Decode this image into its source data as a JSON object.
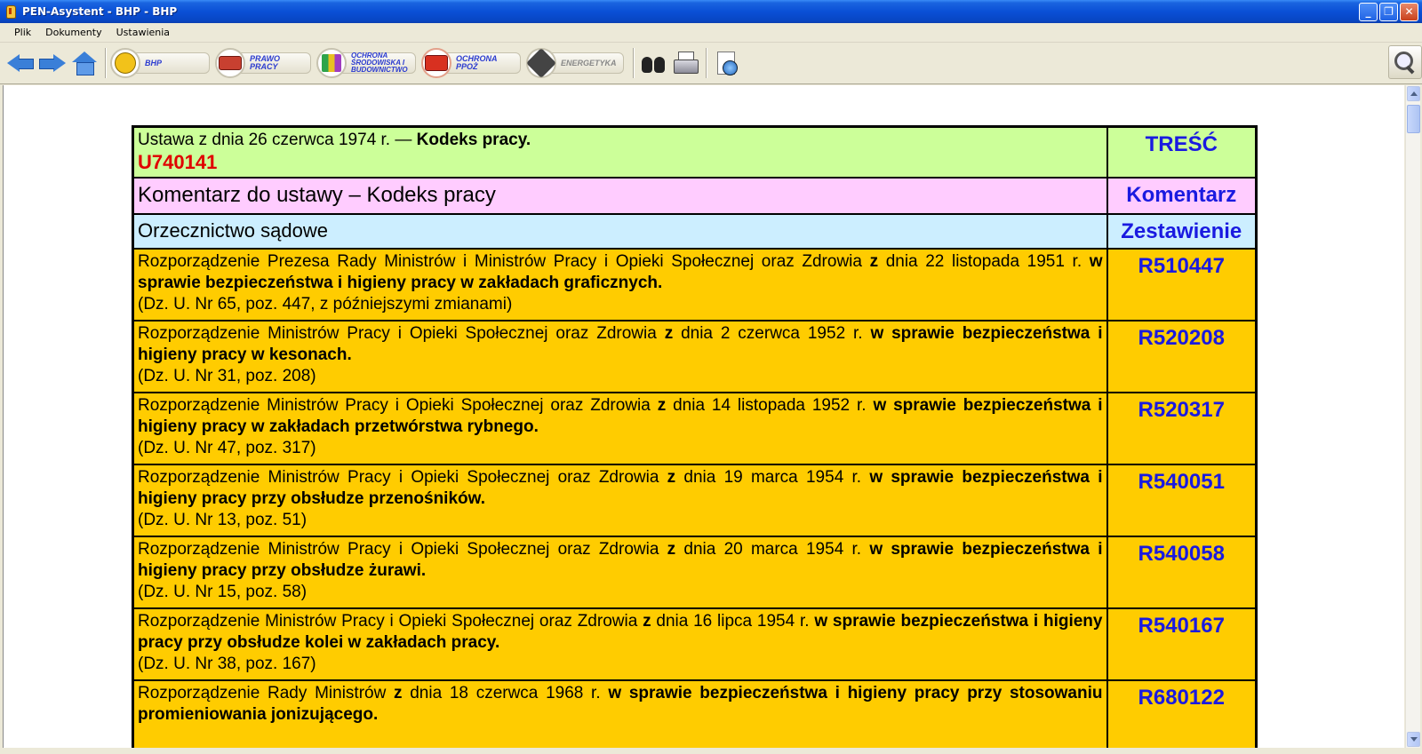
{
  "window": {
    "title": "PEN-Asystent - BHP - BHP",
    "buttons": {
      "minimize": "_",
      "maximize": "❐",
      "close": "✕"
    }
  },
  "menu": [
    "Plik",
    "Dokumenty",
    "Ustawienia"
  ],
  "toolbar": {
    "categories": [
      {
        "id": "bhp",
        "label": "BHP",
        "icon": "safety-worker-icon"
      },
      {
        "id": "prawo-pracy",
        "label": "PRAWO PRACY",
        "icon": "law-building-icon"
      },
      {
        "id": "ochrona",
        "label": "OCHRONA ŚRODOWISKA I BUDOWNICTWO",
        "icon": "environment-icon"
      },
      {
        "id": "ppoz",
        "label": "OCHRONA PPOŻ",
        "icon": "fire-truck-icon"
      },
      {
        "id": "energetyka",
        "label": "ENERGETYKA",
        "icon": "energy-icon"
      }
    ]
  },
  "header_rows": {
    "ustawa": {
      "prefix": "Ustawa z dnia 26 czerwca 1974 r. — ",
      "title": "Kodeks pracy.",
      "code": "U740141",
      "link": "TREŚĆ"
    },
    "komentarz": {
      "text": "Komentarz do ustawy – Kodeks pracy",
      "link": "Komentarz"
    },
    "orzecznictwo": {
      "text": "Orzecznictwo sądowe",
      "link": "Zestawienie"
    }
  },
  "acts": [
    {
      "intro": "Rozporządzenie Prezesa Rady Ministrów i Ministrów Pracy i Opieki Społecznej oraz Zdrowia ",
      "z": "z",
      "date": " dnia 22 listopada 1951 r. ",
      "subject": "w sprawie bezpieczeństwa i higieny pracy w zakładach graficznych.",
      "pub": "(Dz. U. Nr 65, poz. 447, z późniejszymi zmianami)",
      "code": "R510447"
    },
    {
      "intro": "Rozporządzenie Ministrów Pracy i Opieki Społecznej oraz Zdrowia ",
      "z": "z",
      "date": " dnia 2 czerwca 1952 r. ",
      "subject": "w sprawie bezpieczeństwa i higieny pracy w kesonach.",
      "pub": "(Dz. U. Nr 31, poz. 208)",
      "code": "R520208"
    },
    {
      "intro": "Rozporządzenie Ministrów Pracy i Opieki Społecznej oraz Zdrowia ",
      "z": "z",
      "date": " dnia 14 listopada 1952 r. ",
      "subject": "w sprawie bezpieczeństwa i higieny pracy w zakładach przetwórstwa rybnego.",
      "pub": "(Dz. U. Nr 47, poz. 317)",
      "code": "R520317"
    },
    {
      "intro": "Rozporządzenie Ministrów Pracy i Opieki Społecznej oraz Zdrowia ",
      "z": "z",
      "date": " dnia 19 marca 1954 r. ",
      "subject": "w sprawie bezpieczeństwa i higieny pracy przy obsłudze przenośników.",
      "pub": "(Dz. U. Nr 13, poz. 51)",
      "code": "R540051"
    },
    {
      "intro": "Rozporządzenie Ministrów Pracy i Opieki Społecznej oraz Zdrowia ",
      "z": "z",
      "date": " dnia  20 marca 1954 r. ",
      "subject": "w sprawie bezpieczeństwa i higieny pracy przy obsłudze żurawi.",
      "pub": "(Dz. U. Nr 15, poz. 58)",
      "code": "R540058"
    },
    {
      "intro": "Rozporządzenie Ministrów Pracy i Opieki Społecznej oraz Zdrowia ",
      "z": "z",
      "date": " dnia 16 lipca 1954 r. ",
      "subject": "w sprawie bezpieczeństwa i higieny pracy przy obsłudze kolei w zakładach pracy.",
      "pub": "(Dz. U. Nr 38, poz. 167)",
      "code": "R540167"
    },
    {
      "intro": "Rozporządzenie Rady Ministrów ",
      "z": "z",
      "date": " dnia 18 czerwca 1968 r. ",
      "subject": "w sprawie bezpieczeństwa i higieny pracy przy stosowaniu promieniowania jonizującego.",
      "pub": "",
      "code": "R680122"
    }
  ],
  "colors": {
    "green_row": "#ccff99",
    "pink_row": "#ffccff",
    "blue_row": "#cceeff",
    "orange_row": "#ffcc00",
    "link": "#1a1ae0",
    "code_red": "#e00000"
  }
}
